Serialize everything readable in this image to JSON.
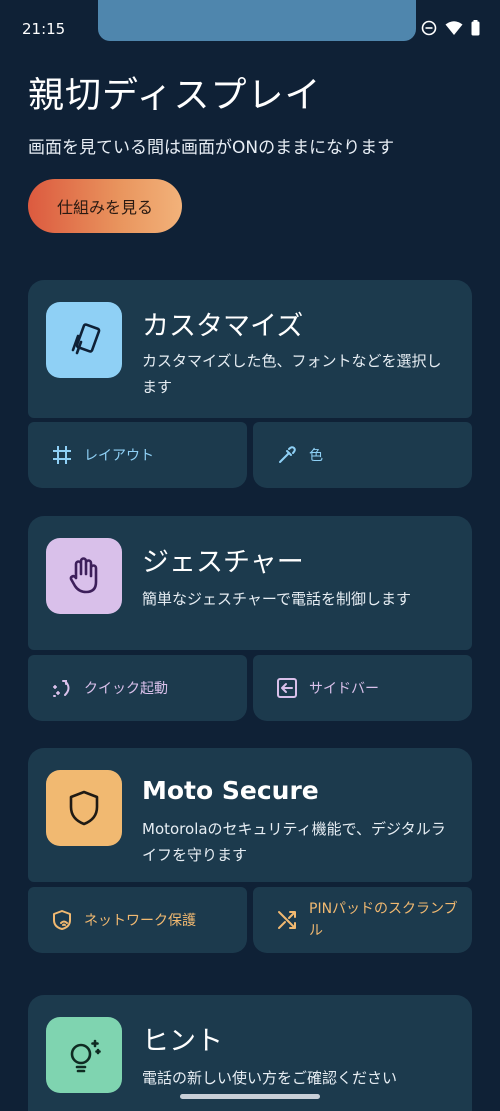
{
  "status_bar": {
    "time": "21:15"
  },
  "header": {
    "title": "親切ディスプレイ",
    "subtitle": "画面を見ている間は画面がONのままになります",
    "how_button": "仕組みを見る"
  },
  "cards": [
    {
      "title": "カスタマイズ",
      "description": "カスタマイズした色、フォントなどを選択します",
      "icon": "cards-icon",
      "icon_bg": "#8fd0f5",
      "actions": [
        {
          "label": "レイアウト",
          "icon": "grid-icon"
        },
        {
          "label": "色",
          "icon": "eyedropper-icon"
        }
      ]
    },
    {
      "title": "ジェスチャー",
      "description": "簡単なジェスチャーで電話を制御します",
      "icon": "hand-icon",
      "icon_bg": "#d9c0ea",
      "actions": [
        {
          "label": "クイック起動",
          "icon": "quick-launch-icon"
        },
        {
          "label": "サイドバー",
          "icon": "sidebar-icon"
        }
      ]
    },
    {
      "title": "Moto Secure",
      "description": "Motorolaのセキュリティ機能で、デジタルライフを守ります",
      "icon": "shield-icon",
      "icon_bg": "#f1b971",
      "actions": [
        {
          "label": "ネットワーク保護",
          "icon": "network-shield-icon"
        },
        {
          "label": "PINパッドのスクランブル",
          "label_line1": "PINパッドのスクランブ",
          "label_line2": "ル",
          "icon": "shuffle-icon"
        }
      ]
    },
    {
      "title": "ヒント",
      "description": "電話の新しい使い方をご確認ください",
      "icon": "lightbulb-icon",
      "icon_bg": "#7fd4b0"
    }
  ]
}
